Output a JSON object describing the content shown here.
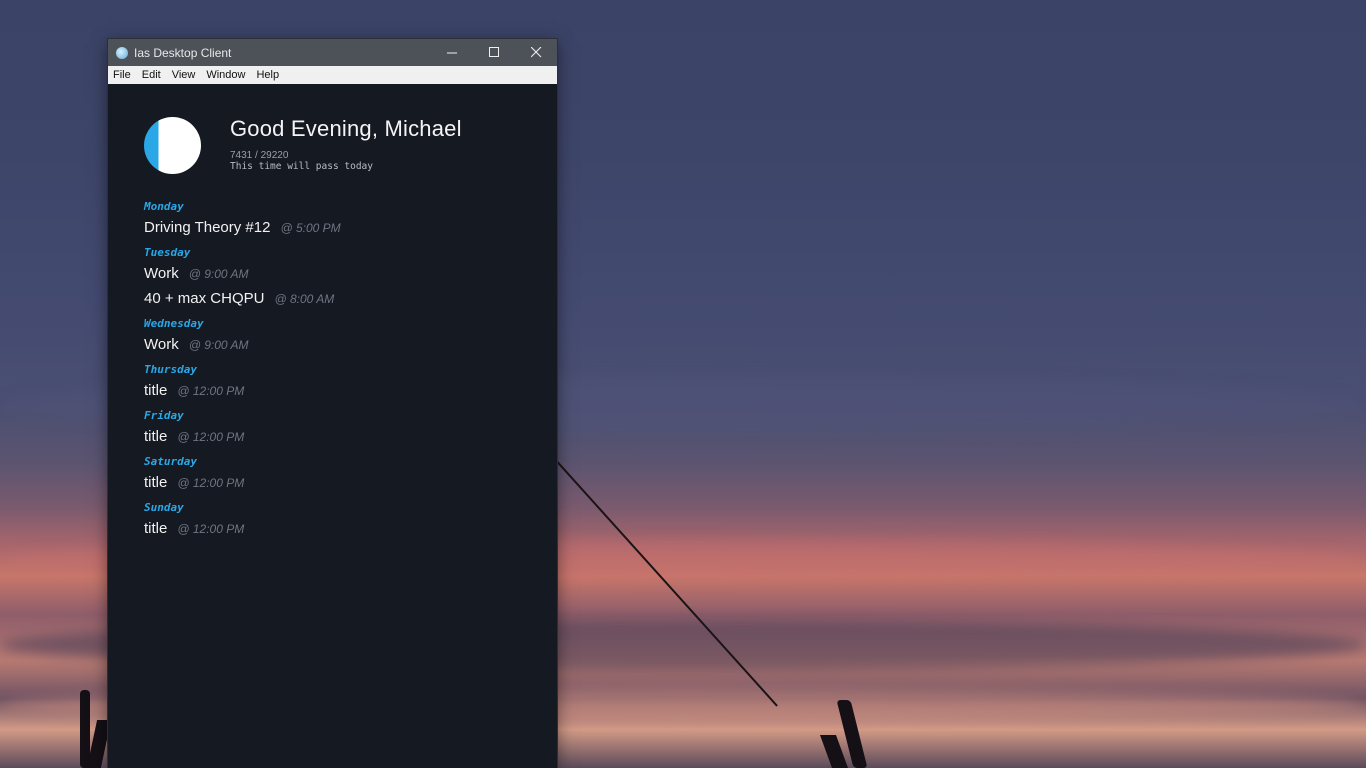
{
  "window": {
    "title": "Ias Desktop Client",
    "controls": {
      "minimize": "—",
      "maximize": "☐",
      "close": "✕"
    }
  },
  "menu": [
    "File",
    "Edit",
    "View",
    "Window",
    "Help"
  ],
  "header": {
    "greeting": "Good Evening, Michael",
    "count": "7431 / 29220",
    "tagline": "This time will pass today",
    "progress": 0.254
  },
  "colors": {
    "accent": "#2aa7e6",
    "window_bg": "#151922",
    "titlebar": "#4d5258"
  },
  "schedule": [
    {
      "day": "Monday",
      "events": [
        {
          "title": "Driving Theory #12",
          "time": "@ 5:00 PM"
        }
      ]
    },
    {
      "day": "Tuesday",
      "events": [
        {
          "title": "Work",
          "time": "@ 9:00 AM"
        },
        {
          "title": "40 + max CHQPU",
          "time": "@ 8:00 AM"
        }
      ]
    },
    {
      "day": "Wednesday",
      "events": [
        {
          "title": "Work",
          "time": "@ 9:00 AM"
        }
      ]
    },
    {
      "day": "Thursday",
      "events": [
        {
          "title": "title",
          "time": "@ 12:00 PM"
        }
      ]
    },
    {
      "day": "Friday",
      "events": [
        {
          "title": "title",
          "time": "@ 12:00 PM"
        }
      ]
    },
    {
      "day": "Saturday",
      "events": [
        {
          "title": "title",
          "time": "@ 12:00 PM"
        }
      ]
    },
    {
      "day": "Sunday",
      "events": [
        {
          "title": "title",
          "time": "@ 12:00 PM"
        }
      ]
    }
  ]
}
